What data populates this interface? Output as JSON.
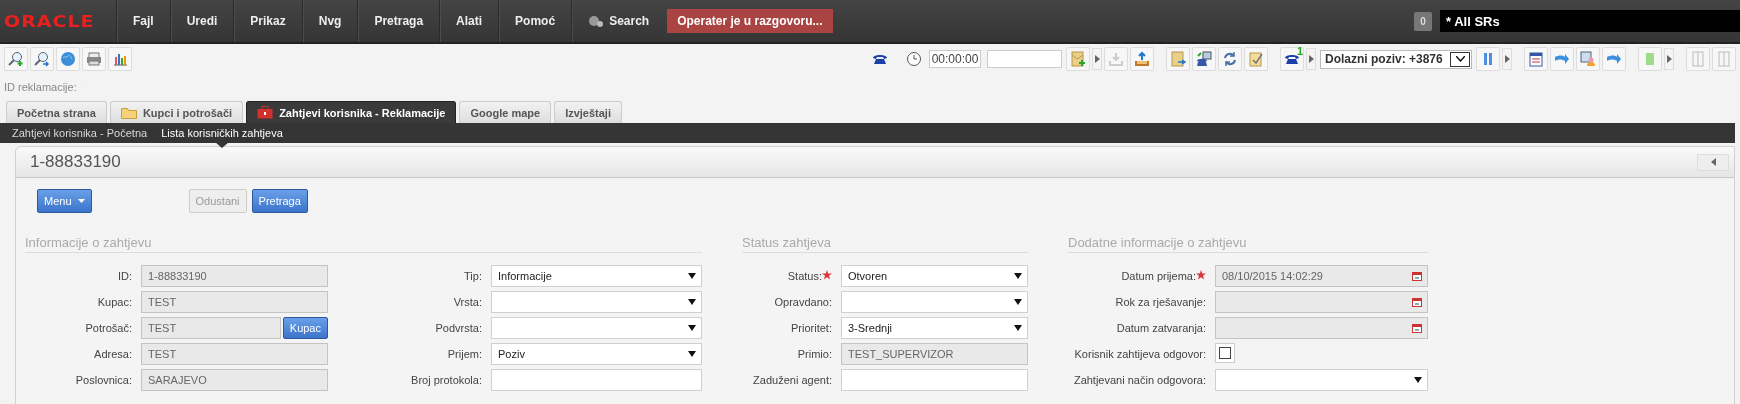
{
  "top_bar": {
    "logo": "ORACLE",
    "menu": [
      "Fajl",
      "Uredi",
      "Prikaz",
      "Nvg",
      "Pretraga",
      "Alati",
      "Pomoć"
    ],
    "search_label": "Search",
    "status_button": "Operater je u razgovoru...",
    "count_badge": "0",
    "query_field": {
      "value": "* All SRs"
    }
  },
  "toolbar": {
    "timer": "00:00:00",
    "line_badge": "1",
    "call_select": "Dolazni poziv: +3876"
  },
  "breadcrumb": "ID reklamacije:",
  "tabs": [
    {
      "label": "Početna strana",
      "selected": false
    },
    {
      "label": "Kupci i potrošači",
      "selected": false
    },
    {
      "label": "Zahtjevi korisnika - Reklamacije",
      "selected": true
    },
    {
      "label": "Google mape",
      "selected": false
    },
    {
      "label": "Izvještaji",
      "selected": false
    }
  ],
  "subtabs": [
    {
      "label": "Zahtjevi korisnika - Početna",
      "selected": false
    },
    {
      "label": "Lista korisničkih zahtjeva",
      "selected": true
    }
  ],
  "record": {
    "title": "1-88833190",
    "buttons": [
      {
        "label": "Menu",
        "kind": "menu",
        "disabled": false
      },
      {
        "label": "Odustani",
        "kind": "plain",
        "disabled": true
      },
      {
        "label": "Pretraga",
        "kind": "plain",
        "disabled": false
      }
    ]
  },
  "sections": [
    {
      "heading": "Informacije o zahtjevu",
      "columns": [
        [
          {
            "label": "ID:",
            "kind": "text",
            "value": "1-88833190",
            "readonly": true,
            "required": false
          },
          {
            "label": "Kupac:",
            "kind": "text",
            "value": "TEST",
            "readonly": true,
            "required": false
          },
          {
            "label": "Potrošač:",
            "kind": "text",
            "value": "TEST",
            "readonly": true,
            "required": false,
            "button": "Kupac"
          },
          {
            "label": "Adresa:",
            "kind": "text",
            "value": "TEST",
            "readonly": true,
            "required": false
          },
          {
            "label": "Poslovnica:",
            "kind": "text",
            "value": "SARAJEVO",
            "readonly": true,
            "required": false
          }
        ],
        [
          {
            "label": "Tip:",
            "kind": "select",
            "value": "Informacije",
            "readonly": false,
            "required": false
          },
          {
            "label": "Vrsta:",
            "kind": "select",
            "readonly": false,
            "required": false
          },
          {
            "label": "Podvrsta:",
            "kind": "select",
            "readonly": false,
            "required": false
          },
          {
            "label": "Prijem:",
            "kind": "select",
            "value": "Poziv",
            "readonly": false,
            "required": false
          },
          {
            "label": "Broj protokola:",
            "kind": "text",
            "readonly": false,
            "required": false
          }
        ]
      ]
    },
    {
      "heading": "Status zahtjeva",
      "columns": [
        [
          {
            "label": "Status:",
            "kind": "select",
            "value": "Otvoren",
            "readonly": false,
            "required": true
          },
          {
            "label": "Opravdano:",
            "kind": "select",
            "readonly": false,
            "required": false
          },
          {
            "label": "Prioritet:",
            "kind": "select",
            "value": "3-Srednji",
            "readonly": false,
            "required": false
          },
          {
            "label": "Primio:",
            "kind": "text",
            "value": "TEST_SUPERVIZOR",
            "readonly": true,
            "required": false
          },
          {
            "label": "Zaduženi agent:",
            "kind": "text",
            "readonly": false,
            "required": false
          }
        ]
      ]
    },
    {
      "heading": "Dodatne informacije o zahtjevu",
      "columns": [
        [
          {
            "label": "Datum prijema:",
            "kind": "date",
            "value": "08/10/2015 14:02:29",
            "readonly": true,
            "required": true
          },
          {
            "label": "Rok za rješavanje:",
            "kind": "date",
            "readonly": true,
            "required": false
          },
          {
            "label": "Datum zatvaranja:",
            "kind": "date",
            "readonly": true,
            "required": false
          },
          {
            "label": "Korisnik zahtijeva odgovor:",
            "kind": "checkbox",
            "checked": false,
            "required": false
          },
          {
            "label": "Zahtjevani način odgovora:",
            "kind": "select",
            "readonly": false,
            "required": false
          }
        ]
      ]
    }
  ]
}
